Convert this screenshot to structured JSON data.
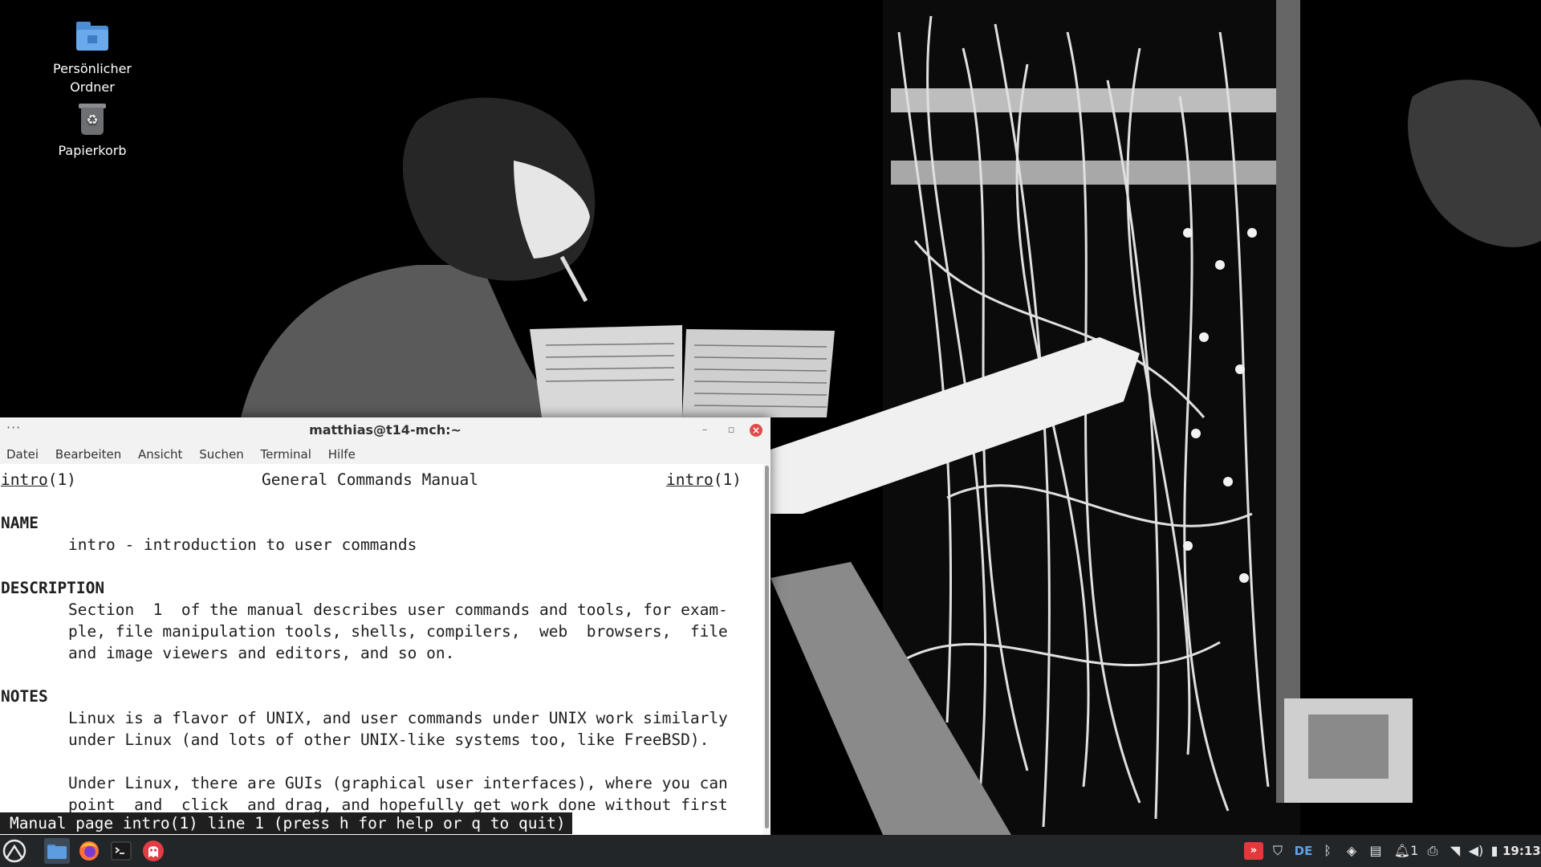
{
  "desktop": {
    "icons": [
      {
        "label_line1": "Persönlicher",
        "label_line2": "Ordner",
        "icon": "home-folder-icon"
      },
      {
        "label_line1": "Papierkorb",
        "icon": "trash-icon"
      }
    ]
  },
  "window": {
    "title": "matthias@t14-mch:~",
    "menu_dots": "···",
    "controls": {
      "minimize": "–",
      "maximize": "▫",
      "close": "×"
    },
    "menu": [
      "Datei",
      "Bearbeiten",
      "Ansicht",
      "Suchen",
      "Terminal",
      "Hilfe"
    ]
  },
  "man_page": {
    "header_left": "intro",
    "header_left_suffix": "(1)",
    "header_center": "General Commands Manual",
    "header_right": "intro",
    "header_right_suffix": "(1)",
    "name_heading": "NAME",
    "name_text": "intro - introduction to user commands",
    "description_heading": "DESCRIPTION",
    "description_lines": [
      "Section  1  of the manual describes user commands and tools, for exam-",
      "ple, file manipulation tools, shells, compilers,  web  browsers,  file",
      "and image viewers and editors, and so on."
    ],
    "notes_heading": "NOTES",
    "notes_lines": [
      "Linux is a flavor of UNIX, and user commands under UNIX work similarly",
      "under Linux (and lots of other UNIX-like systems too, like FreeBSD).",
      "",
      "Under Linux, there are GUIs (graphical user interfaces), where you can",
      "point  and  click  and drag, and hopefully get work done without first"
    ],
    "status_line": "Manual page intro(1) line 1 (press h for help or q to quit)"
  },
  "taskbar": {
    "apps": [
      "menu-icon",
      "file-manager-icon",
      "firefox-icon",
      "terminal-icon",
      "ghost-app-icon"
    ],
    "tray": {
      "keyboard_layout": "DE",
      "notifications_count": "1",
      "clock": "19:13"
    }
  },
  "colors": {
    "taskbar_bg": "#232629",
    "close_button": "#e04c4c",
    "tray_accent_red": "#e3393c",
    "layout_blue": "#5ea1ea"
  }
}
